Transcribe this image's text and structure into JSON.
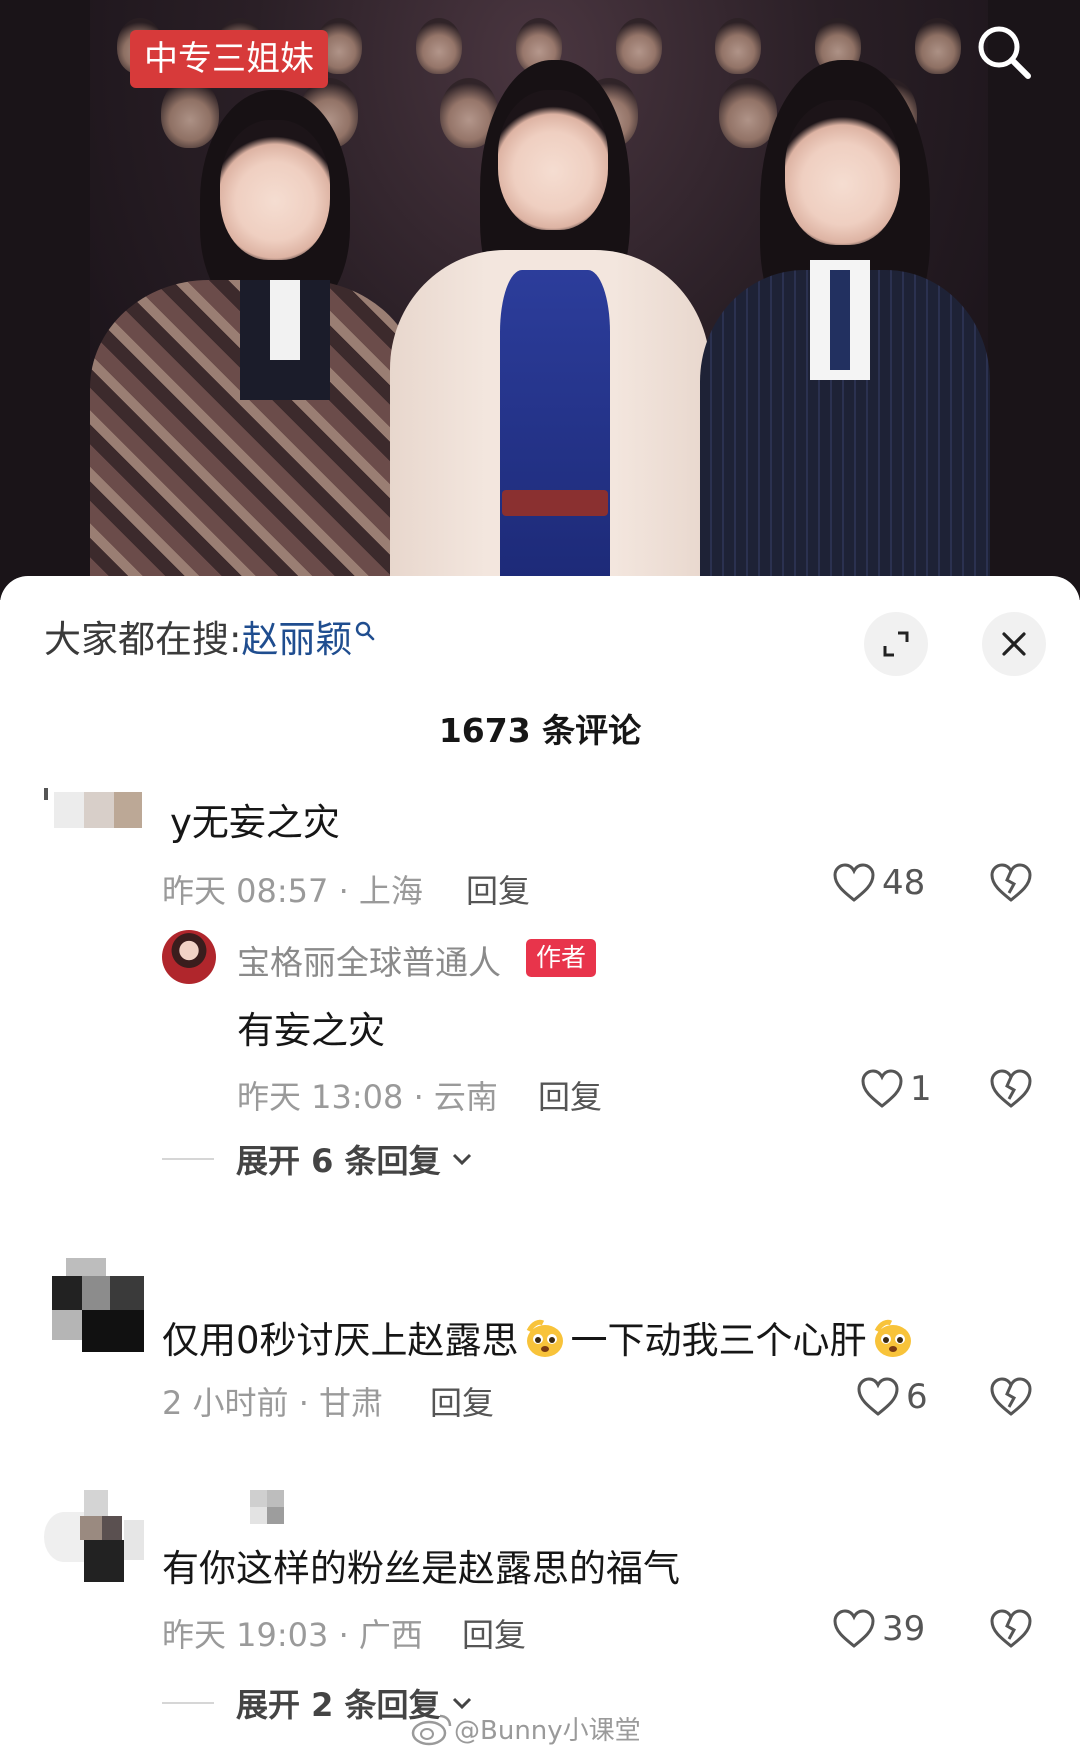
{
  "video": {
    "tag_label": "中专三姐妹"
  },
  "sheet": {
    "search_prefix": "大家都在搜:",
    "search_keyword": "赵丽颖",
    "comment_count_label": "1673 条评论"
  },
  "comments": [
    {
      "text": "y无妄之灾",
      "time_location": "昨天 08:57 · 上海",
      "reply_label": "回复",
      "likes": "48",
      "replies": [
        {
          "username": "宝格丽全球普通人",
          "badge": "作者",
          "text": "有妄之灾",
          "time_location": "昨天 13:08 · 云南",
          "reply_label": "回复",
          "likes": "1"
        }
      ],
      "expand_label": "展开 6 条回复"
    },
    {
      "text_part1": "仅用0秒讨厌上赵露思",
      "text_part2": "一下动我三个心肝",
      "time_location": "2 小时前 · 甘肃",
      "reply_label": "回复",
      "likes": "6"
    },
    {
      "text": "有你这样的粉丝是赵露思的福气",
      "time_location": "昨天 19:03 · 广西",
      "reply_label": "回复",
      "likes": "39",
      "expand_label": "展开 2 条回复"
    }
  ],
  "watermark": {
    "text": "@Bunny小课堂"
  },
  "colors": {
    "tag_red": "#d73a3a",
    "keyword_blue": "#1f4d8f",
    "author_badge": "#e8344b",
    "meta_gray": "#9a9a9a"
  },
  "icons": {
    "search": "search-icon",
    "expand": "expand-icon",
    "close": "close-icon",
    "like": "heart-icon",
    "dislike": "broken-heart-icon",
    "chevron": "chevron-down-icon",
    "emoji": "pleading-face-emoji"
  }
}
